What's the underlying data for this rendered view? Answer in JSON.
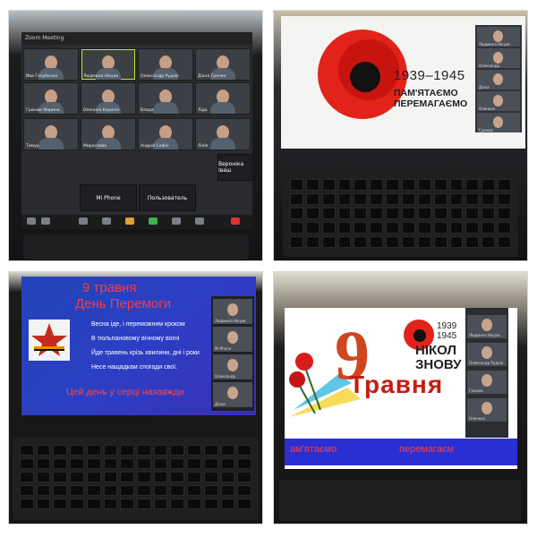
{
  "panel1": {
    "header": "Zoom Meeting",
    "tiles": [
      {
        "name": "Ива Голубенко",
        "cam": true
      },
      {
        "name": "Людмила Нікуак",
        "cam": true
      },
      {
        "name": "Олександр Руднік",
        "cam": true
      },
      {
        "name": "Діана Гречин",
        "cam": true
      },
      {
        "name": "Гринюк Марина",
        "cam": true
      },
      {
        "name": "Оленька Каренін",
        "cam": true
      },
      {
        "name": "Влада",
        "cam": true
      },
      {
        "name": "Ліда",
        "cam": true
      },
      {
        "name": "Тимур",
        "cam": true
      },
      {
        "name": "Мирослава",
        "cam": true
      },
      {
        "name": "Андрій Сафін",
        "cam": true
      },
      {
        "name": "Лілія",
        "cam": true
      }
    ],
    "name_tiles": [
      "Вероніка Іваш",
      "Mi Phone",
      "Пользователь"
    ],
    "toolbar_icons": [
      "mic-icon",
      "video-icon",
      "security-icon",
      "participants-icon",
      "chat-icon",
      "share-screen-icon",
      "record-icon",
      "reactions-icon",
      "end-call-icon"
    ]
  },
  "panel2": {
    "years": "1939–1945",
    "line1": "ПАМ'ЯТАЄМО",
    "line2": "ПЕРЕМАГАЄМО",
    "strip_names": [
      "Людмила Нікуак",
      "Олександр",
      "Діана",
      "Оленька",
      "Гринюк"
    ]
  },
  "panel3": {
    "title1": "9 травня",
    "title2": "День Перемоги",
    "poem": [
      "Весна іде, і переможним кроком",
      "В тюльпановому вічному вогні",
      "Йде травень крізь хвилини, дні і роки",
      "Несе нащадкам спогади свої."
    ],
    "closing": "Цей день у серці назавжди",
    "strip_names": [
      "Людмила Нікуак",
      "Mi Phone",
      "Олександр",
      "Діана"
    ]
  },
  "panel4": {
    "number": "9",
    "word": "Травня",
    "years_top": "1939",
    "years_bottom": "1945",
    "nikoly": "НІКОЛ",
    "znovu": "ЗНОВУ",
    "band_left": "ам'ятаємо",
    "band_right": "перемагаєм",
    "strip_names": [
      "Людмила Нікуак",
      "Олександр Руднік",
      "Гринюк",
      "Оленька"
    ]
  },
  "colors": {
    "poppy_red": "#e2231a",
    "slide_blue": "#2f3fc4",
    "zoom_dark": "#1b1b1b"
  }
}
